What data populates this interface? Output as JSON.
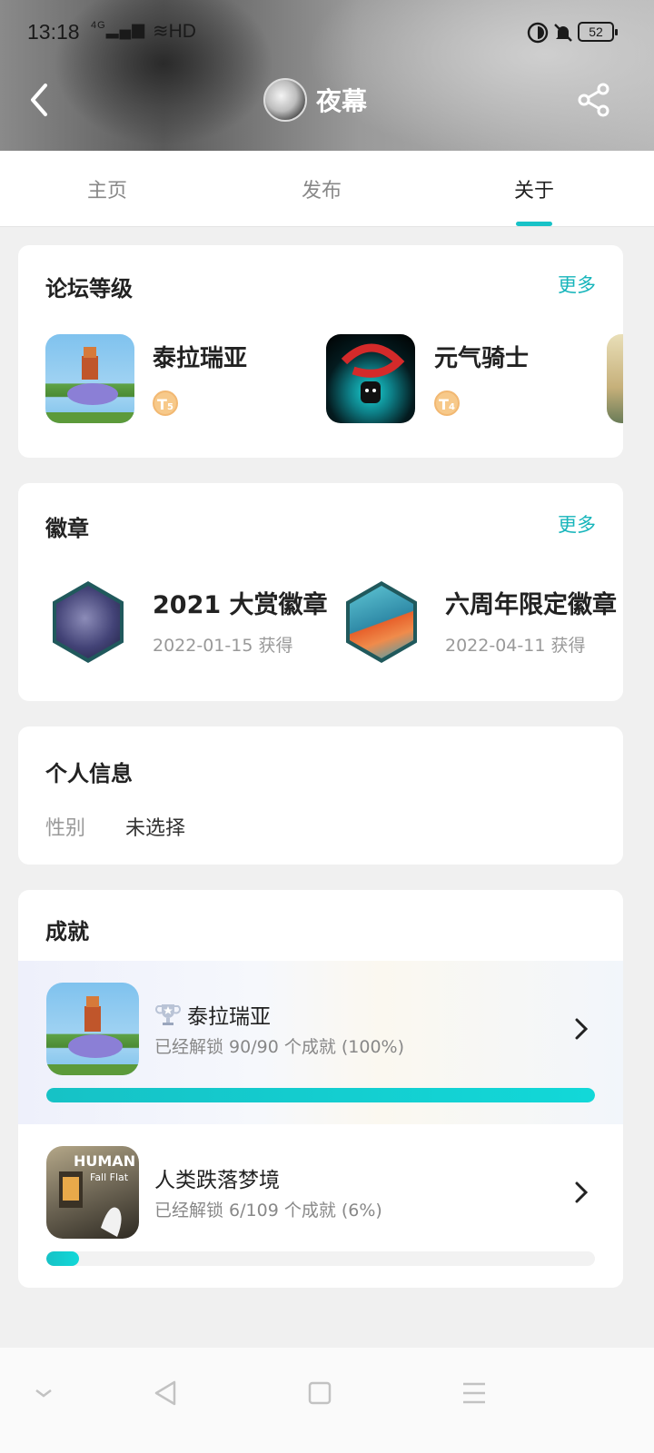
{
  "status_bar": {
    "time": "13:18",
    "signal": "4G",
    "network": "HD",
    "battery": "52"
  },
  "header": {
    "username": "夜幕"
  },
  "tabs": [
    {
      "label": "主页"
    },
    {
      "label": "发布"
    },
    {
      "label": "关于",
      "active": true
    }
  ],
  "forum_levels": {
    "title": "论坛等级",
    "more": "更多",
    "items": [
      {
        "name": "泰拉瑞亚",
        "level": "5",
        "icon": "terraria-icon"
      },
      {
        "name": "元气骑士",
        "level": "4",
        "icon": "soul-knight-icon"
      }
    ]
  },
  "badges": {
    "title": "徽章",
    "more": "更多",
    "items": [
      {
        "name": "2021 大赏徽章",
        "date": "2022-01-15 获得"
      },
      {
        "name": "六周年限定徽章",
        "date": "2022-04-11 获得"
      }
    ]
  },
  "personal_info": {
    "title": "个人信息",
    "gender_label": "性别",
    "gender_value": "未选择"
  },
  "achievements": {
    "title": "成就",
    "items": [
      {
        "name": "泰拉瑞亚",
        "progress_text": "已经解锁 90/90 个成就 (100%)",
        "progress": 1.0,
        "trophy": true
      },
      {
        "name": "人类跌落梦境",
        "progress_text": "已经解锁 6/109 个成就 (6%)",
        "progress": 0.06,
        "trophy": false
      }
    ]
  },
  "colors": {
    "accent": "#17c2c7",
    "more_link": "#17b5bb"
  }
}
